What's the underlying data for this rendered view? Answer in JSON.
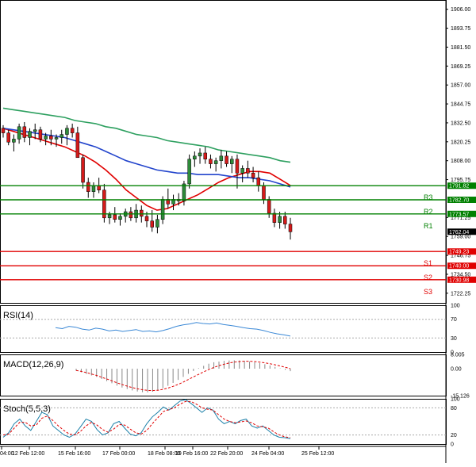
{
  "chart_data": {
    "type": "candlestick",
    "instrument_note": "",
    "price_axis": {
      "ticks": [
        "1906.00",
        "1893.75",
        "1881.50",
        "1869.25",
        "1857.00",
        "1844.75",
        "1832.50",
        "1820.25",
        "1808.00",
        "1795.75",
        "1771.25",
        "1759.00",
        "1746.75",
        "1734.50",
        "1722.25"
      ],
      "range": [
        1716,
        1912
      ]
    },
    "time_axis": {
      "labels": [
        "04:00",
        "12 Feb 12:00",
        "15 Feb 16:00",
        "17 Feb 00:00",
        "18 Feb 08:00",
        "19 Feb 16:00",
        "22 Feb 20:00",
        "24 Feb 04:00",
        "25 Feb 12:00"
      ]
    },
    "levels": [
      {
        "name": "R3",
        "value": 1791.82,
        "label": "1791.82",
        "color": "#008000"
      },
      {
        "name": "R2",
        "value": 1782.7,
        "label": "1782.70",
        "color": "#008000"
      },
      {
        "name": "R1",
        "value": 1773.57,
        "label": "1773.57",
        "color": "#008000"
      },
      {
        "name": "S1",
        "value": 1749.23,
        "label": "1749.23",
        "color": "#e00000"
      },
      {
        "name": "S2",
        "value": 1740.0,
        "label": "1740.00",
        "color": "#e00000"
      },
      {
        "name": "S3",
        "value": 1730.98,
        "label": "1730.98",
        "color": "#e00000"
      }
    ],
    "current_price": {
      "value": 1762.04,
      "label": "1762.04"
    },
    "candles": [
      [
        1829,
        1831,
        1823,
        1826
      ],
      [
        1826,
        1828,
        1818,
        1820
      ],
      [
        1820,
        1825,
        1814,
        1822
      ],
      [
        1822,
        1832,
        1819,
        1830
      ],
      [
        1830,
        1833,
        1820,
        1823
      ],
      [
        1823,
        1829,
        1818,
        1827
      ],
      [
        1827,
        1832,
        1822,
        1828
      ],
      [
        1828,
        1830,
        1820,
        1822
      ],
      [
        1822,
        1826,
        1818,
        1824
      ],
      [
        1824,
        1828,
        1818,
        1822
      ],
      [
        1822,
        1825,
        1817,
        1823
      ],
      [
        1823,
        1828,
        1819,
        1825
      ],
      [
        1825,
        1831,
        1818,
        1829
      ],
      [
        1829,
        1832,
        1823,
        1826
      ],
      [
        1826,
        1830,
        1815,
        1810
      ],
      [
        1810,
        1812,
        1790,
        1794
      ],
      [
        1794,
        1797,
        1784,
        1788
      ],
      [
        1788,
        1794,
        1784,
        1792
      ],
      [
        1792,
        1797,
        1787,
        1789
      ],
      [
        1789,
        1793,
        1768,
        1771
      ],
      [
        1771,
        1775,
        1767,
        1773
      ],
      [
        1773,
        1778,
        1768,
        1770
      ],
      [
        1770,
        1774,
        1766,
        1772
      ],
      [
        1772,
        1777,
        1768,
        1775
      ],
      [
        1775,
        1778,
        1769,
        1771
      ],
      [
        1771,
        1780,
        1768,
        1776
      ],
      [
        1776,
        1779,
        1768,
        1772
      ],
      [
        1772,
        1775,
        1765,
        1769
      ],
      [
        1769,
        1776,
        1762,
        1765
      ],
      [
        1765,
        1773,
        1761,
        1770
      ],
      [
        1770,
        1785,
        1767,
        1783
      ],
      [
        1783,
        1790,
        1777,
        1780
      ],
      [
        1780,
        1786,
        1776,
        1783
      ],
      [
        1783,
        1787,
        1779,
        1782
      ],
      [
        1782,
        1795,
        1779,
        1793
      ],
      [
        1793,
        1812,
        1790,
        1809
      ],
      [
        1809,
        1814,
        1804,
        1811
      ],
      [
        1811,
        1816,
        1806,
        1813
      ],
      [
        1813,
        1817,
        1806,
        1809
      ],
      [
        1809,
        1812,
        1803,
        1806
      ],
      [
        1806,
        1810,
        1801,
        1808
      ],
      [
        1808,
        1815,
        1803,
        1811
      ],
      [
        1811,
        1814,
        1804,
        1806
      ],
      [
        1806,
        1811,
        1800,
        1809
      ],
      [
        1809,
        1812,
        1790,
        1800
      ],
      [
        1800,
        1805,
        1794,
        1803
      ],
      [
        1803,
        1808,
        1797,
        1800
      ],
      [
        1800,
        1804,
        1794,
        1797
      ],
      [
        1797,
        1801,
        1788,
        1792
      ],
      [
        1792,
        1794,
        1780,
        1783
      ],
      [
        1783,
        1785,
        1771,
        1774
      ],
      [
        1774,
        1777,
        1765,
        1768
      ],
      [
        1768,
        1775,
        1764,
        1772
      ],
      [
        1772,
        1775,
        1764,
        1767
      ],
      [
        1767,
        1771,
        1757,
        1762
      ]
    ],
    "moving_averages": [
      {
        "color": "#e00000",
        "values": [
          1829,
          1827,
          1825,
          1823,
          1821,
          1819,
          1817,
          1814,
          1811,
          1807,
          1802,
          1796,
          1789,
          1784,
          1779,
          1776,
          1777,
          1780,
          1783,
          1786,
          1790,
          1794,
          1797,
          1799,
          1801,
          1801,
          1800,
          1796,
          1792
        ]
      },
      {
        "color": "#2244cc",
        "values": [
          1829,
          1828,
          1827,
          1826,
          1825,
          1824,
          1823,
          1821,
          1819,
          1817,
          1814,
          1811,
          1808,
          1806,
          1804,
          1802,
          1801,
          1800,
          1800,
          1799,
          1799,
          1799,
          1798,
          1797,
          1797,
          1796,
          1795,
          1793,
          1791
        ]
      },
      {
        "color": "#2ea060",
        "values": [
          1842,
          1841,
          1840,
          1839,
          1838,
          1837,
          1836,
          1834,
          1833,
          1832,
          1830,
          1829,
          1827,
          1825,
          1824,
          1823,
          1821,
          1820,
          1819,
          1818,
          1817,
          1815,
          1814,
          1813,
          1812,
          1811,
          1810,
          1808,
          1807
        ]
      }
    ],
    "indicators": [
      {
        "name": "RSI(14)",
        "levels": [
          "100",
          "70",
          "30",
          "0"
        ],
        "color": "#3a88d6",
        "values": [
          52,
          50,
          55,
          53,
          49,
          47,
          51,
          49,
          45,
          47,
          44,
          46,
          48,
          44,
          45,
          43,
          46,
          50,
          55,
          58,
          60,
          63,
          61,
          60,
          62,
          59,
          57,
          55,
          52,
          50,
          49,
          46,
          42,
          39,
          37,
          34
        ]
      },
      {
        "name": "MACD(12,26,9)",
        "levels": [
          "8.005",
          "0.00",
          "-15.126"
        ],
        "color": "#000000",
        "signal_color": "#e00000",
        "histogram": [
          -1.2,
          -2.0,
          -3.0,
          -3.8,
          -4.6,
          -5.8,
          -7.0,
          -8.2,
          -9.5,
          -10.6,
          -11.4,
          -12.2,
          -12.8,
          -13.2,
          -13.3,
          -12.9,
          -12.1,
          -11.0,
          -9.6,
          -8.0,
          -6.3,
          -4.6,
          -2.9,
          -1.3,
          0.3,
          1.6,
          2.8,
          3.6,
          4.0,
          4.4,
          4.6,
          4.7,
          4.6,
          4.4,
          4.0,
          3.6,
          3.1,
          2.5,
          1.8,
          1.0,
          0.2,
          -0.6,
          -1.4
        ],
        "signal": [
          -1,
          -1.5,
          -2.2,
          -3,
          -3.8,
          -4.8,
          -5.8,
          -6.8,
          -7.9,
          -8.9,
          -9.8,
          -10.6,
          -11.3,
          -11.8,
          -12.2,
          -12.3,
          -12.1,
          -11.6,
          -10.9,
          -9.9,
          -8.8,
          -7.5,
          -6.1,
          -4.6,
          -3.2,
          -1.8,
          -0.5,
          0.7,
          1.7,
          2.5,
          3.2,
          3.7,
          4.0,
          4.2,
          4.2,
          4.0,
          3.7,
          3.3,
          2.8,
          2.2,
          1.5,
          0.8,
          0.0
        ]
      },
      {
        "name": "Stoch(5,5,3)",
        "levels": [
          "100",
          "80",
          "20",
          "0"
        ],
        "color": "#1a7fa8",
        "signal_color": "#e00000",
        "k": [
          15,
          25,
          45,
          55,
          40,
          30,
          50,
          70,
          65,
          40,
          30,
          20,
          15,
          22,
          38,
          55,
          50,
          32,
          20,
          25,
          45,
          50,
          35,
          22,
          18,
          25,
          45,
          60,
          70,
          82,
          75,
          85,
          95,
          98,
          90,
          80,
          70,
          80,
          75,
          55,
          45,
          50,
          45,
          52,
          55,
          40,
          35,
          40,
          30,
          20,
          15,
          14,
          12
        ],
        "d": [
          20,
          22,
          35,
          48,
          48,
          40,
          42,
          57,
          62,
          52,
          40,
          30,
          22,
          20,
          28,
          40,
          48,
          42,
          32,
          26,
          33,
          43,
          42,
          33,
          25,
          22,
          30,
          45,
          58,
          72,
          76,
          80,
          88,
          94,
          94,
          88,
          80,
          77,
          75,
          65,
          55,
          50,
          47,
          49,
          51,
          47,
          40,
          38,
          35,
          27,
          20,
          16,
          14
        ]
      }
    ]
  }
}
